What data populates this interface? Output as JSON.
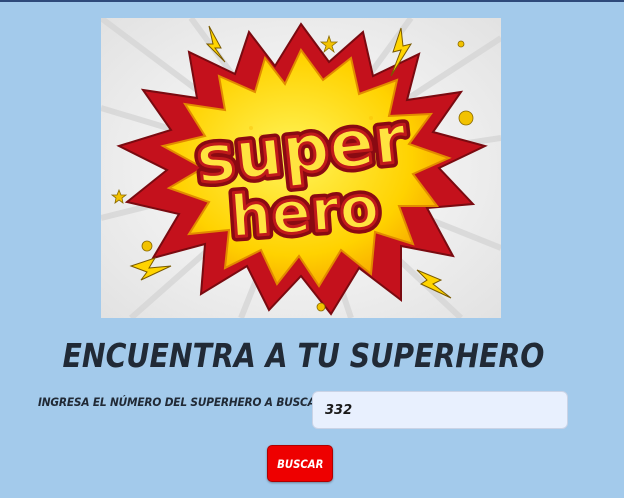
{
  "banner": {
    "logo_line1": "super",
    "logo_line2": "hero"
  },
  "page_title": "ENCUENTRA A TU SUPERHERO",
  "search": {
    "label": "INGRESA EL NÚMERO DEL SUPERHERO A BUSCAR:",
    "value": "332",
    "button_label": "BUSCAR"
  },
  "colors": {
    "page_background": "#a3caeb",
    "button": "#ee0000",
    "input_background": "#e8f0fe",
    "title_text": "#212a36"
  }
}
